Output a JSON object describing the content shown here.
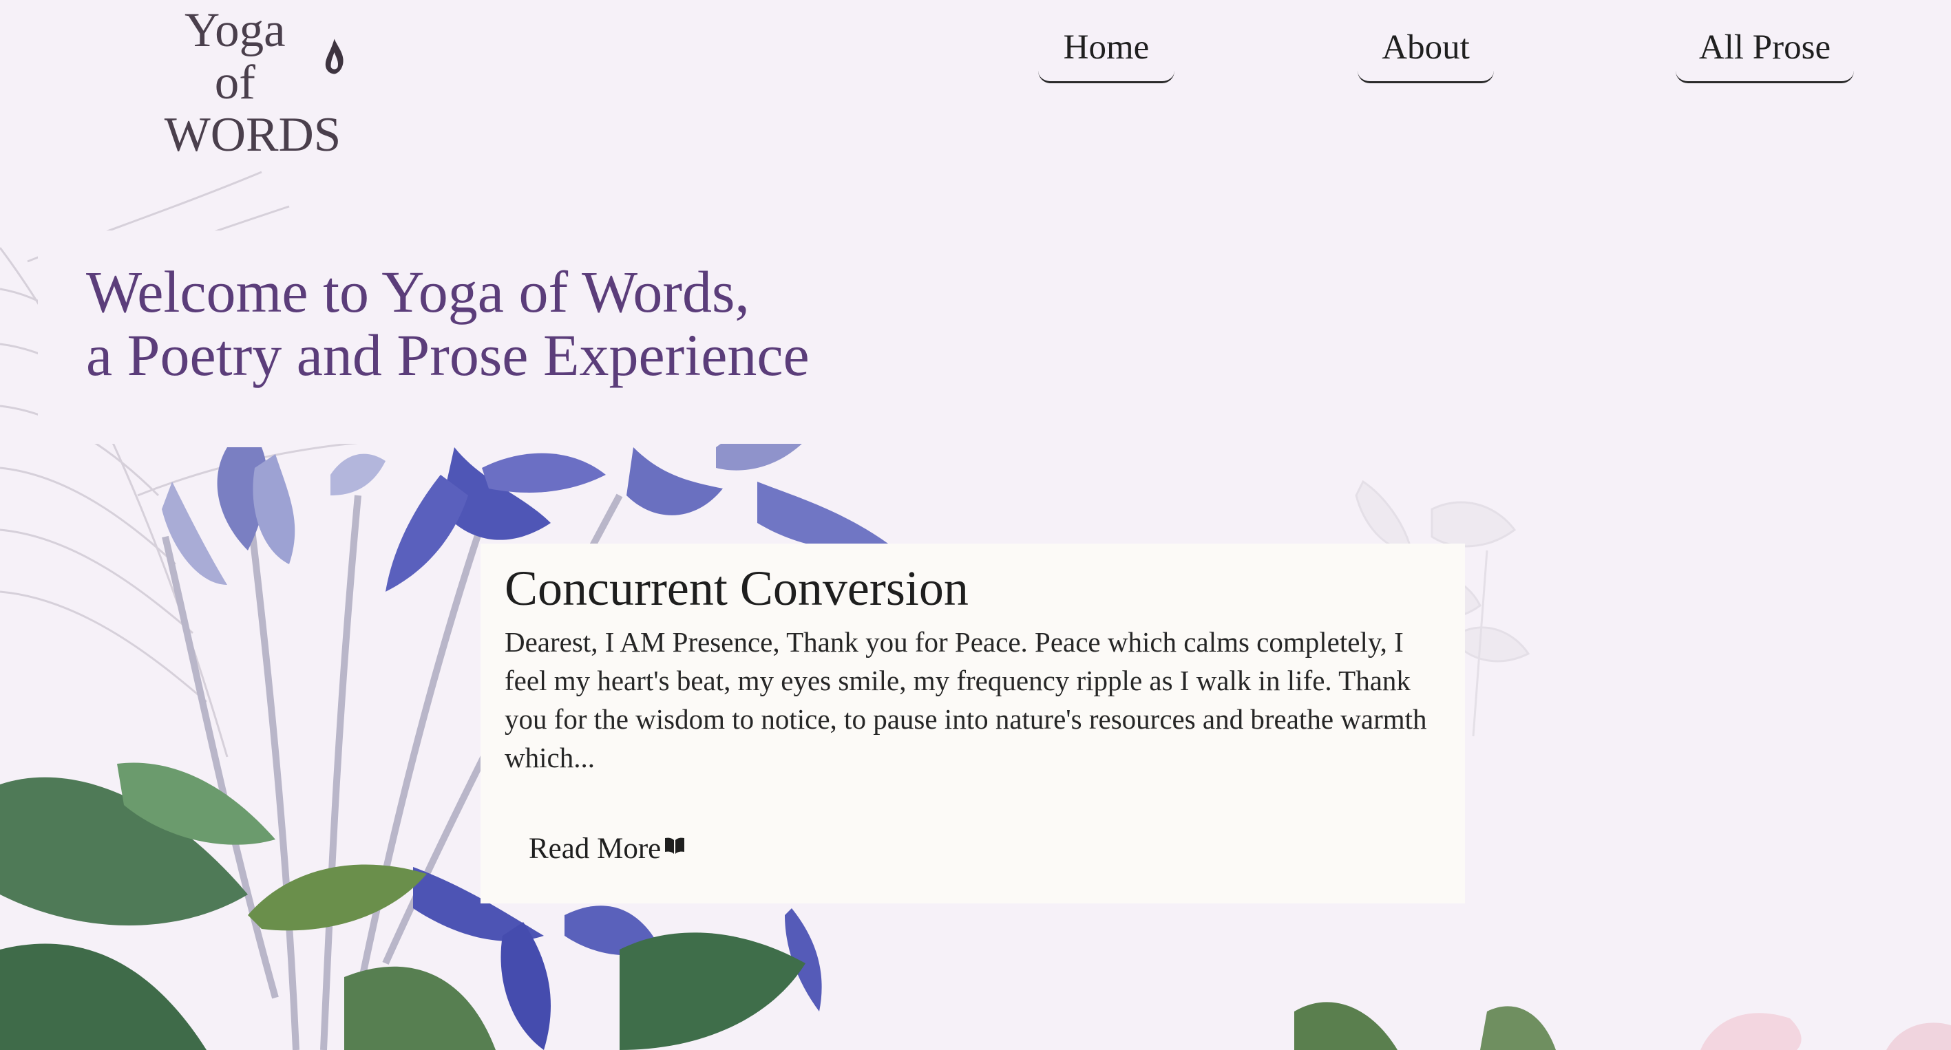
{
  "logo": {
    "line1": "Yoga of",
    "line2": "WORDS",
    "icon": "flame-icon"
  },
  "nav": {
    "home": "Home",
    "about": "About",
    "all_prose": "All Prose"
  },
  "hero": {
    "line1": "Welcome to Yoga of Words,",
    "line2": "a Poetry and Prose Experience"
  },
  "post": {
    "title": "Concurrent Conversion",
    "excerpt": "Dearest, I AM Presence, Thank you for Peace. Peace which calms completely, I feel my heart's beat, my eyes smile, my frequency ripple as I walk in life. Thank you for the wisdom to notice, to pause into nature's resources and breathe warmth which...",
    "read_more": "Read More",
    "read_more_icon": "open-book-icon"
  },
  "colors": {
    "background": "#f6f1f8",
    "heading_purple": "#5b3d7a",
    "card_background": "#fcfaf7",
    "flower_blue": "#5c5cb8",
    "leaf_green": "#4f7a57"
  }
}
